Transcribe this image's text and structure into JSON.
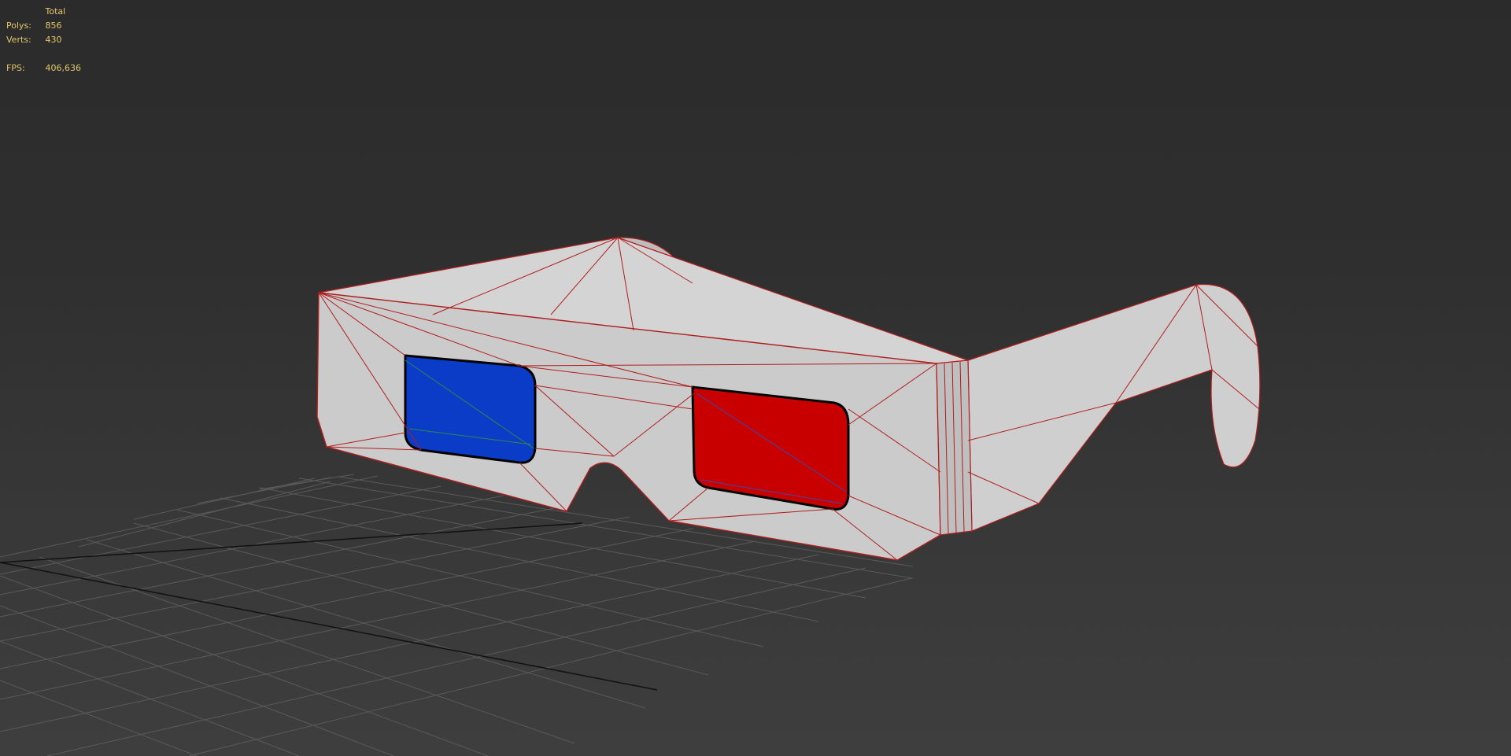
{
  "viewport": {
    "background_top": "#2b2b2b",
    "background_bottom": "#3e3e3e",
    "grid_color": "#5a5a5a",
    "axis_color": "#111111"
  },
  "stats": {
    "header": "Total",
    "polys_label": "Polys:",
    "polys_value": "856",
    "verts_label": "Verts:",
    "verts_value": "430",
    "fps_label": "FPS:",
    "fps_value": "406,636",
    "text_color": "#e3c86a"
  },
  "model": {
    "frame_color": "#c8c8c8",
    "wire_color": "#b01e1e",
    "left_lens_color": "#0a3cc8",
    "right_lens_color": "#c80000"
  }
}
